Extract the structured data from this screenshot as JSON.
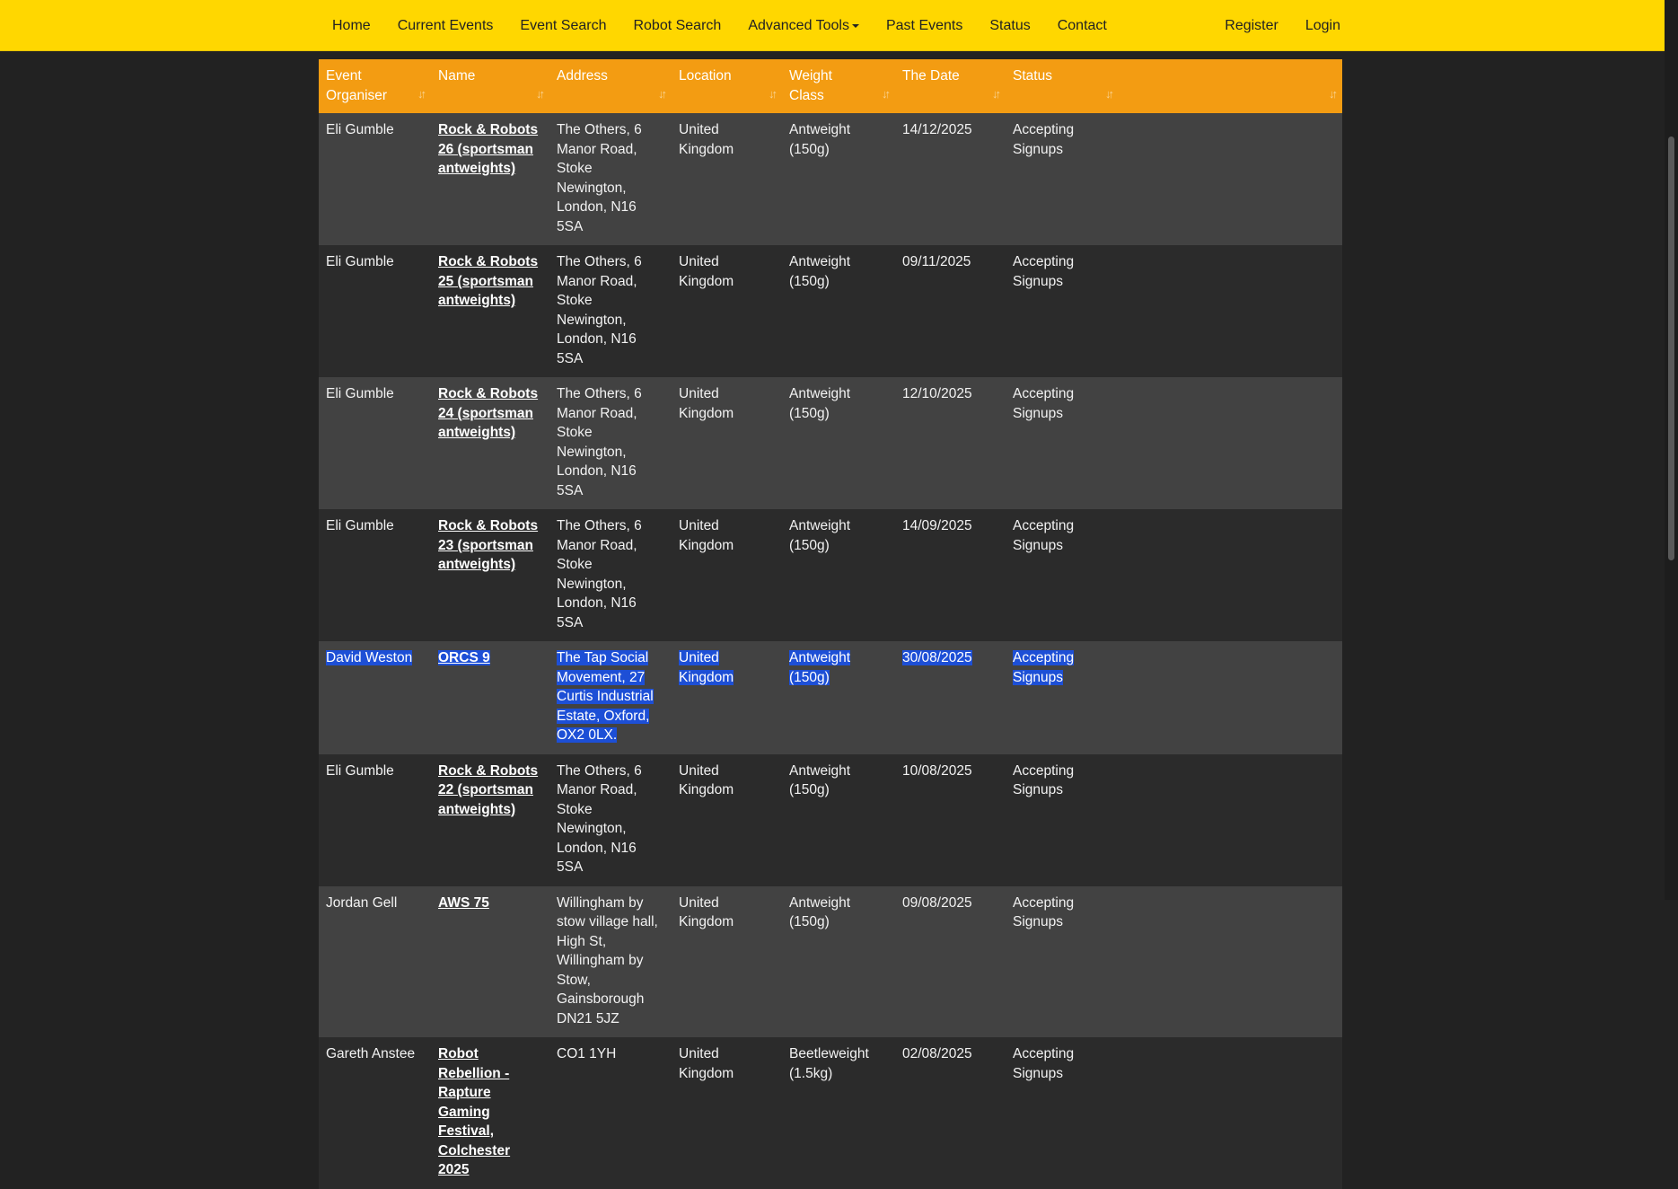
{
  "nav": {
    "left": [
      {
        "label": "Home"
      },
      {
        "label": "Current Events"
      },
      {
        "label": "Event Search"
      },
      {
        "label": "Robot Search"
      },
      {
        "label": "Advanced Tools",
        "dropdown": true
      },
      {
        "label": "Past Events"
      },
      {
        "label": "Status"
      },
      {
        "label": "Contact"
      }
    ],
    "right": [
      {
        "label": "Register"
      },
      {
        "label": "Login"
      }
    ]
  },
  "table": {
    "columns": [
      "Event Organiser",
      "Name",
      "Address",
      "Location",
      "Weight Class",
      "The Date",
      "Status",
      ""
    ],
    "sort_icon": "sort-arrows-icon",
    "rows": [
      {
        "organiser": "Eli Gumble",
        "name": "Rock & Robots 26 (sportsman antweights)",
        "address": "The Others, 6 Manor Road, Stoke Newington, London, N16 5SA",
        "location": "United Kingdom",
        "weight": "Antweight (150g)",
        "date": "14/12/2025",
        "status": "Accepting Signups"
      },
      {
        "organiser": "Eli Gumble",
        "name": "Rock & Robots 25 (sportsman antweights)",
        "address": "The Others, 6 Manor Road, Stoke Newington, London, N16 5SA",
        "location": "United Kingdom",
        "weight": "Antweight (150g)",
        "date": "09/11/2025",
        "status": "Accepting Signups"
      },
      {
        "organiser": "Eli Gumble",
        "name": "Rock & Robots 24 (sportsman antweights)",
        "address": "The Others, 6 Manor Road, Stoke Newington, London, N16 5SA",
        "location": "United Kingdom",
        "weight": "Antweight (150g)",
        "date": "12/10/2025",
        "status": "Accepting Signups"
      },
      {
        "organiser": "Eli Gumble",
        "name": "Rock & Robots 23 (sportsman antweights)",
        "address": "The Others, 6 Manor Road, Stoke Newington, London, N16 5SA",
        "location": "United Kingdom",
        "weight": "Antweight (150g)",
        "date": "14/09/2025",
        "status": "Accepting Signups"
      },
      {
        "organiser": "David Weston",
        "name": "ORCS 9",
        "address": "The Tap Social Movement, 27 Curtis Industrial Estate, Oxford, OX2 0LX.",
        "location": "United Kingdom",
        "weight": "Antweight (150g)",
        "date": "30/08/2025",
        "status": "Accepting Signups",
        "selected": true
      },
      {
        "organiser": "Eli Gumble",
        "name": "Rock & Robots 22 (sportsman antweights)",
        "address": "The Others, 6 Manor Road, Stoke Newington, London, N16 5SA",
        "location": "United Kingdom",
        "weight": "Antweight (150g)",
        "date": "10/08/2025",
        "status": "Accepting Signups"
      },
      {
        "organiser": "Jordan Gell",
        "name": "AWS 75",
        "address": "Willingham by stow village hall, High St, Willingham by Stow, Gainsborough DN21 5JZ",
        "location": "United Kingdom",
        "weight": "Antweight (150g)",
        "date": "09/08/2025",
        "status": "Accepting Signups"
      },
      {
        "organiser": "Gareth Anstee",
        "name": "Robot Rebellion - Rapture Gaming Festival, Colchester 2025",
        "address": "CO1 1YH",
        "location": "United Kingdom",
        "weight": "Beetleweight (1.5kg)",
        "date": "02/08/2025",
        "status": "Accepting Signups"
      }
    ]
  },
  "colors": {
    "navbar": "#ffd700",
    "header": "#f39c12",
    "row_odd": "#424242",
    "row_even": "#2b2b2b",
    "selection": "#1d4fd6"
  }
}
